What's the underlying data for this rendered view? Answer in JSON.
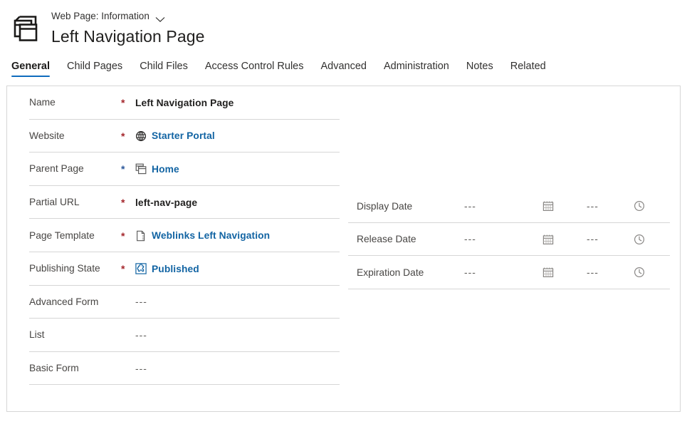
{
  "header": {
    "entity_label": "Web Page: Information",
    "chevron_icon": "chevron-down-icon",
    "record_title": "Left Navigation Page",
    "app_icon": "web-pages-icon"
  },
  "tabs": [
    {
      "label": "General",
      "selected": true
    },
    {
      "label": "Child Pages",
      "selected": false
    },
    {
      "label": "Child Files",
      "selected": false
    },
    {
      "label": "Access Control Rules",
      "selected": false
    },
    {
      "label": "Advanced",
      "selected": false
    },
    {
      "label": "Administration",
      "selected": false
    },
    {
      "label": "Notes",
      "selected": false
    },
    {
      "label": "Related",
      "selected": false
    }
  ],
  "form": {
    "left_fields": [
      {
        "label": "Name",
        "required_marker": "*",
        "required_type": "required",
        "value": "Left Navigation Page",
        "value_type": "text",
        "icon": ""
      },
      {
        "label": "Website",
        "required_marker": "*",
        "required_type": "required",
        "value": "Starter Portal",
        "value_type": "link",
        "icon": "globe-icon"
      },
      {
        "label": "Parent Page",
        "required_marker": "*",
        "required_type": "recommended",
        "value": "Home",
        "value_type": "link",
        "icon": "stacked-windows-icon"
      },
      {
        "label": "Partial URL",
        "required_marker": "*",
        "required_type": "required",
        "value": "left-nav-page",
        "value_type": "text",
        "icon": ""
      },
      {
        "label": "Page Template",
        "required_marker": "*",
        "required_type": "required",
        "value": "Weblinks Left Navigation",
        "value_type": "link",
        "icon": "document-icon"
      },
      {
        "label": "Publishing State",
        "required_marker": "*",
        "required_type": "required",
        "value": "Published",
        "value_type": "link",
        "icon": "puzzle-box-icon"
      },
      {
        "label": "Advanced Form",
        "required_marker": "",
        "required_type": "none",
        "value": "---",
        "value_type": "empty",
        "icon": ""
      },
      {
        "label": "List",
        "required_marker": "",
        "required_type": "none",
        "value": "---",
        "value_type": "empty",
        "icon": ""
      },
      {
        "label": "Basic Form",
        "required_marker": "",
        "required_type": "none",
        "value": "---",
        "value_type": "empty",
        "icon": ""
      }
    ],
    "date_fields": [
      {
        "label": "Display Date",
        "date_value": "---",
        "date_icon": "calendar-icon",
        "time_value": "---",
        "time_icon": "clock-icon"
      },
      {
        "label": "Release Date",
        "date_value": "---",
        "date_icon": "calendar-icon",
        "time_value": "---",
        "time_icon": "clock-icon"
      },
      {
        "label": "Expiration Date",
        "date_value": "---",
        "date_icon": "calendar-icon",
        "time_value": "---",
        "time_icon": "clock-icon"
      }
    ]
  },
  "colors": {
    "link": "#1264a3",
    "accent": "#0f6cbd",
    "required": "#a4262c",
    "recommended": "#2b579a",
    "separator": "#d6d6d6"
  }
}
